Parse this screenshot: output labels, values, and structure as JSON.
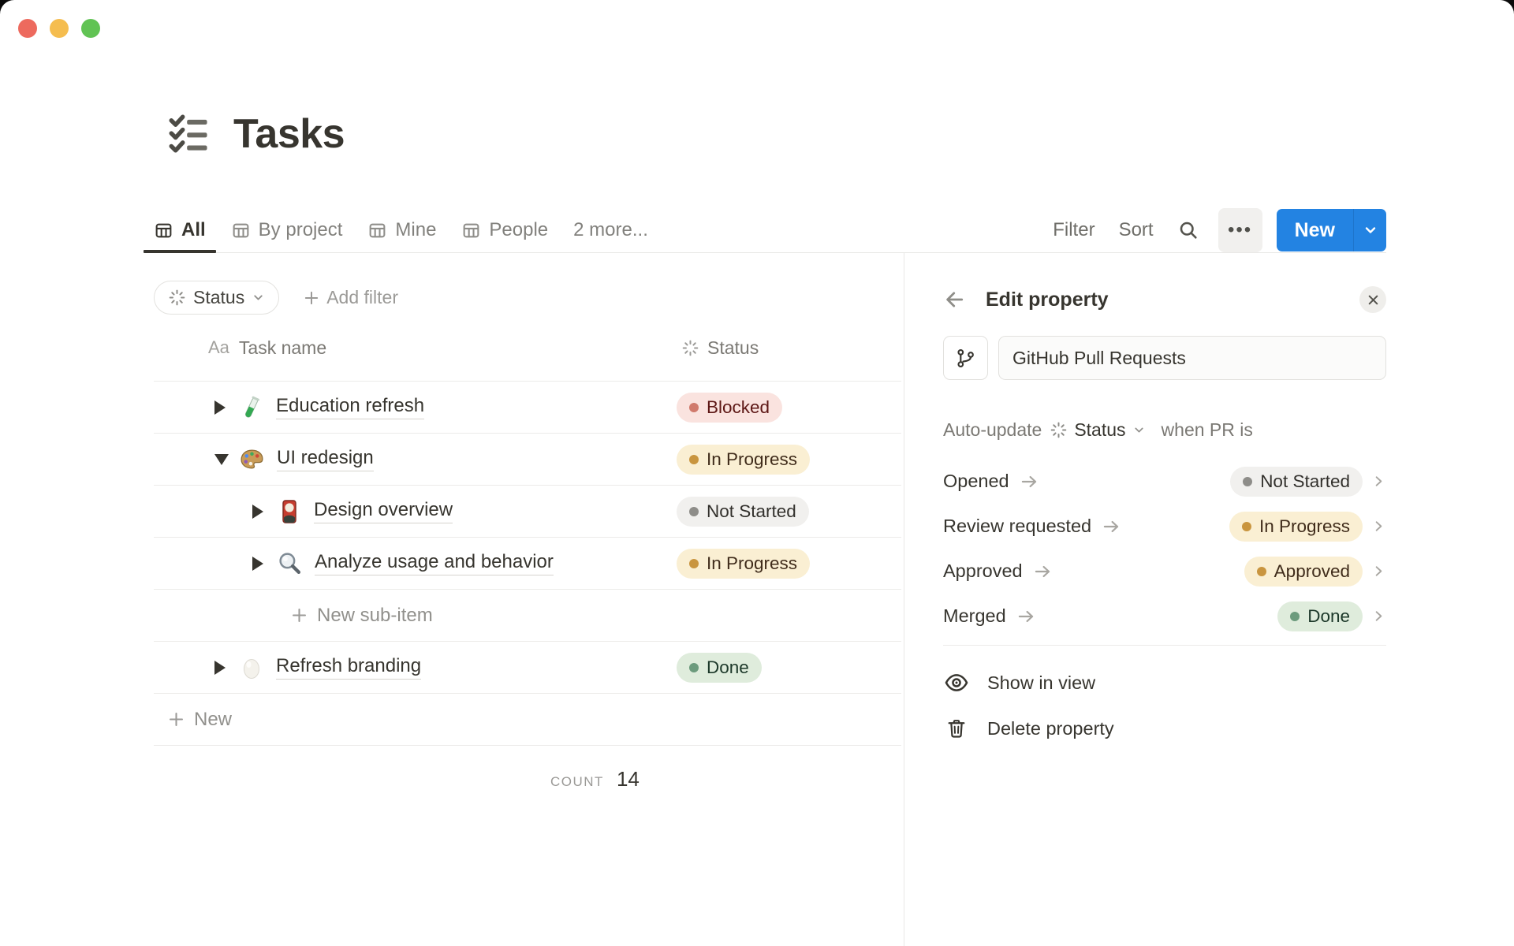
{
  "window": {
    "traffic_lights": [
      "close",
      "minimize",
      "zoom"
    ]
  },
  "page": {
    "title": "Tasks"
  },
  "tabs": {
    "items": [
      {
        "label": "All",
        "icon": "table-view-icon",
        "active": true
      },
      {
        "label": "By project",
        "icon": "table-view-icon",
        "active": false
      },
      {
        "label": "Mine",
        "icon": "table-view-icon",
        "active": false
      },
      {
        "label": "People",
        "icon": "table-view-icon",
        "active": false
      },
      {
        "label": "2 more...",
        "icon": "",
        "active": false
      }
    ]
  },
  "toolbar": {
    "filter_label": "Filter",
    "sort_label": "Sort",
    "search_icon": "search-icon",
    "more_label": "•••",
    "new_label": "New"
  },
  "filter_bar": {
    "status_chip_label": "Status",
    "add_filter_label": "Add filter"
  },
  "table": {
    "columns": [
      {
        "icon_glyph": "Aa",
        "label": "Task name"
      },
      {
        "icon": "status-burst-icon",
        "label": "Status"
      }
    ],
    "rows": [
      {
        "name": "Education refresh",
        "emoji": "test-tube-icon",
        "status": "Blocked",
        "status_color": "red",
        "level": 0,
        "toggle": "collapsed"
      },
      {
        "name": "UI redesign",
        "emoji": "palette-icon",
        "status": "In Progress",
        "status_color": "yellow",
        "level": 0,
        "toggle": "expanded"
      },
      {
        "name": "Design overview",
        "emoji": "flower-card-icon",
        "status": "Not Started",
        "status_color": "gray",
        "level": 1,
        "toggle": "collapsed"
      },
      {
        "name": "Analyze usage and behavior",
        "emoji": "magnifier-icon",
        "status": "In Progress",
        "status_color": "yellow",
        "level": 1,
        "toggle": "collapsed"
      },
      {
        "name": "Refresh branding",
        "emoji": "egg-icon",
        "status": "Done",
        "status_color": "green",
        "level": 0,
        "toggle": "collapsed"
      }
    ],
    "new_sub_item_label": "New sub-item",
    "new_row_label": "New",
    "footer": {
      "count_label": "COUNT",
      "count_value": "14"
    }
  },
  "panel": {
    "title": "Edit property",
    "back_icon": "back-arrow-icon",
    "close_icon": "close-icon",
    "property_type_icon": "git-branch-icon",
    "property_name": "GitHub Pull Requests",
    "auto_update": {
      "prefix": "Auto-update",
      "property": "Status",
      "suffix": "when PR is"
    },
    "mappings": [
      {
        "event": "Opened",
        "status": "Not Started",
        "color": "gray"
      },
      {
        "event": "Review requested",
        "status": "In Progress",
        "color": "yellow"
      },
      {
        "event": "Approved",
        "status": "Approved",
        "color": "yellow"
      },
      {
        "event": "Merged",
        "status": "Done",
        "color": "green"
      }
    ],
    "actions": [
      {
        "label": "Show in view",
        "icon": "eye-icon"
      },
      {
        "label": "Delete property",
        "icon": "trash-icon"
      }
    ]
  },
  "colors": {
    "accent_blue": "#2383E2",
    "text_dark": "#37352F",
    "badge_red_bg": "#FAE3DF",
    "badge_red_text": "#5D1715",
    "badge_yellow_bg": "#FAEFD3",
    "badge_yellow_text": "#402C1B",
    "badge_gray_bg": "#F1F0EE",
    "badge_gray_text": "#32302C",
    "badge_green_bg": "#DFECDC",
    "badge_green_text": "#1C3829",
    "traffic_red": "#ED6A5E",
    "traffic_yellow": "#F5BD4F",
    "traffic_green": "#61C354"
  }
}
